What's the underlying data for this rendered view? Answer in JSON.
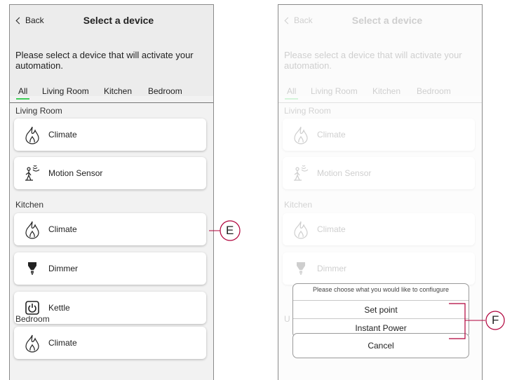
{
  "screen": {
    "back_label": "Back",
    "title": "Select a device",
    "instruction": "Please select a device that will activate your automation.",
    "tabs": [
      "All",
      "Living Room",
      "Kitchen",
      "Bedroom"
    ],
    "sections": {
      "living_room": "Living Room",
      "kitchen": "Kitchen",
      "bedroom": "Bedroom"
    },
    "devices": {
      "living_climate": "Climate",
      "motion_sensor": "Motion Sensor",
      "kitchen_climate": "Climate",
      "dimmer": "Dimmer",
      "kettle": "Kettle",
      "bedroom_climate": "Climate"
    },
    "hidden_section_fragment": "U"
  },
  "dialog": {
    "prompt": "Please choose what you would like to confiugure",
    "options": [
      "Set point",
      "Instant Power"
    ],
    "cancel_label": "Cancel"
  },
  "callouts": {
    "left": "E",
    "right": "F"
  },
  "colors": {
    "tab_underline": "#3dcd58",
    "callout_line": "#b0003a"
  },
  "icons": {
    "climate": "flame-icon",
    "motion_sensor": "motion-sensor-icon",
    "dimmer": "bulb-icon",
    "kettle": "power-icon"
  }
}
